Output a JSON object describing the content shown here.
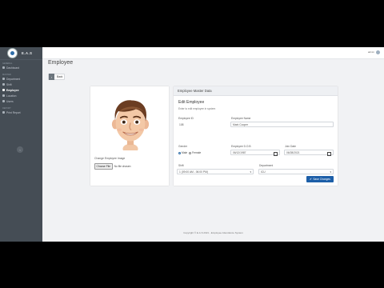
{
  "brand": {
    "name": "E.A.S"
  },
  "sidebar": {
    "section_general": "General",
    "section_master": "Master",
    "section_report": "Report",
    "items": [
      {
        "label": "Dashboard",
        "icon": "gauge-icon"
      },
      {
        "label": "Department",
        "icon": "building-icon"
      },
      {
        "label": "Shift",
        "icon": "clock-icon"
      },
      {
        "label": "Employee",
        "icon": "users-icon"
      },
      {
        "label": "Location",
        "icon": "map-marker-icon"
      },
      {
        "label": "Users",
        "icon": "user-icon"
      },
      {
        "label": "Print Report",
        "icon": "print-icon"
      }
    ],
    "active_item": "Employee",
    "collapse_label": "‹"
  },
  "topbar": {
    "user_name": "admin"
  },
  "page": {
    "title": "Employee",
    "back_label": "Back"
  },
  "image_card": {
    "change_label": "Change Employee Image",
    "file_button": "Choose File",
    "file_status": "No file chosen"
  },
  "form": {
    "header": "Employee Master Data",
    "section_title": "Edit Employee",
    "section_subtitle": "Enter to edit employee in system",
    "employee_id": {
      "label": "Employee ID",
      "value": "108"
    },
    "employee_name": {
      "label": "Employee Name",
      "value": "Mark Cooper"
    },
    "gender": {
      "label": "Gender",
      "options": [
        "Male",
        "Female"
      ],
      "selected": "Male"
    },
    "employee_dob": {
      "label": "Employee D.O.B",
      "value": "06/12/1987"
    },
    "join_date": {
      "label": "Join Date",
      "value": "06/28/2021"
    },
    "shift": {
      "label": "Shift",
      "value": "1 (09:00 AM - 06:00 PM)"
    },
    "department": {
      "label": "Department",
      "value": "ICU"
    },
    "save_label": "Save Changes"
  },
  "footer": {
    "text": "Copyright © E.A.S 2021 - Employee Attendance System"
  },
  "colors": {
    "sidebar": "#454d55",
    "accent": "#1d5fa8",
    "background": "#f1f2f4"
  }
}
